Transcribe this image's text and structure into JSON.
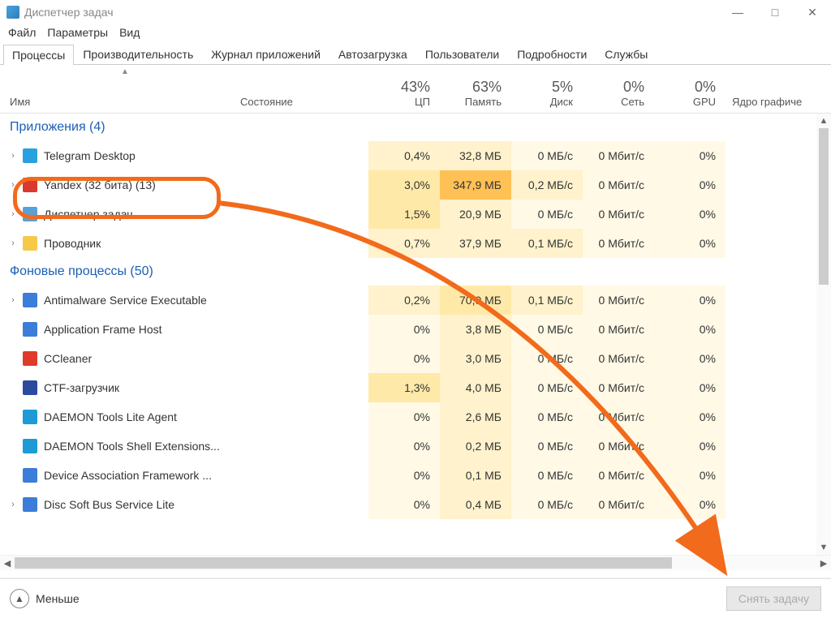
{
  "window": {
    "title": "Диспетчер задач"
  },
  "menubar": {
    "file": "Файл",
    "options": "Параметры",
    "view": "Вид"
  },
  "tabs": {
    "active": 0,
    "items": [
      "Процессы",
      "Производительность",
      "Журнал приложений",
      "Автозагрузка",
      "Пользователи",
      "Подробности",
      "Службы"
    ]
  },
  "columns": {
    "name": "Имя",
    "state": "Состояние",
    "cpu_pct": "43%",
    "cpu_lbl": "ЦП",
    "mem_pct": "63%",
    "mem_lbl": "Память",
    "disk_pct": "5%",
    "disk_lbl": "Диск",
    "net_pct": "0%",
    "net_lbl": "Сеть",
    "gpu_pct": "0%",
    "gpu_lbl": "GPU",
    "gpuEng_lbl": "Ядро графиче"
  },
  "groups": {
    "apps": "Приложения (4)",
    "bg": "Фоновые процессы (50)"
  },
  "rows": {
    "apps": [
      {
        "name": "Telegram Desktop",
        "icon": "#2aa1de",
        "expand": true,
        "cpu": "0,4%",
        "cpu_h": 1,
        "mem": "32,8 МБ",
        "mem_h": 1,
        "disk": "0 МБ/с",
        "disk_h": 0,
        "net": "0 Мбит/с",
        "net_h": 0,
        "gpu": "0%",
        "gpu_h": 0
      },
      {
        "name": "Yandex (32 бита) (13)",
        "icon": "#d93a2b",
        "expand": true,
        "cpu": "3,0%",
        "cpu_h": 2,
        "mem": "347,9 МБ",
        "mem_h": 4,
        "disk": "0,2 МБ/с",
        "disk_h": 1,
        "net": "0 Мбит/с",
        "net_h": 0,
        "gpu": "0%",
        "gpu_h": 0
      },
      {
        "name": "Диспетчер задач",
        "icon": "#5aa0d8",
        "expand": true,
        "cpu": "1,5%",
        "cpu_h": 2,
        "mem": "20,9 МБ",
        "mem_h": 1,
        "disk": "0 МБ/с",
        "disk_h": 0,
        "net": "0 Мбит/с",
        "net_h": 0,
        "gpu": "0%",
        "gpu_h": 0
      },
      {
        "name": "Проводник",
        "icon": "#f7c948",
        "expand": true,
        "cpu": "0,7%",
        "cpu_h": 1,
        "mem": "37,9 МБ",
        "mem_h": 1,
        "disk": "0,1 МБ/с",
        "disk_h": 1,
        "net": "0 Мбит/с",
        "net_h": 0,
        "gpu": "0%",
        "gpu_h": 0
      }
    ],
    "bg": [
      {
        "name": "Antimalware Service Executable",
        "icon": "#3b7dd8",
        "expand": true,
        "cpu": "0,2%",
        "cpu_h": 1,
        "mem": "70,9 МБ",
        "mem_h": 2,
        "disk": "0,1 МБ/с",
        "disk_h": 1,
        "net": "0 Мбит/с",
        "net_h": 0,
        "gpu": "0%",
        "gpu_h": 0
      },
      {
        "name": "Application Frame Host",
        "icon": "#3b7dd8",
        "expand": false,
        "cpu": "0%",
        "cpu_h": 0,
        "mem": "3,8 МБ",
        "mem_h": 1,
        "disk": "0 МБ/с",
        "disk_h": 0,
        "net": "0 Мбит/с",
        "net_h": 0,
        "gpu": "0%",
        "gpu_h": 0
      },
      {
        "name": "CCleaner",
        "icon": "#e03b2a",
        "expand": false,
        "cpu": "0%",
        "cpu_h": 0,
        "mem": "3,0 МБ",
        "mem_h": 1,
        "disk": "0 МБ/с",
        "disk_h": 0,
        "net": "0 Мбит/с",
        "net_h": 0,
        "gpu": "0%",
        "gpu_h": 0
      },
      {
        "name": "CTF-загрузчик",
        "icon": "#2b4aa0",
        "expand": false,
        "cpu": "1,3%",
        "cpu_h": 2,
        "mem": "4,0 МБ",
        "mem_h": 1,
        "disk": "0 МБ/с",
        "disk_h": 0,
        "net": "0 Мбит/с",
        "net_h": 0,
        "gpu": "0%",
        "gpu_h": 0
      },
      {
        "name": "DAEMON Tools Lite Agent",
        "icon": "#1e9ad6",
        "expand": false,
        "cpu": "0%",
        "cpu_h": 0,
        "mem": "2,6 МБ",
        "mem_h": 1,
        "disk": "0 МБ/с",
        "disk_h": 0,
        "net": "0 Мбит/с",
        "net_h": 0,
        "gpu": "0%",
        "gpu_h": 0
      },
      {
        "name": "DAEMON Tools Shell Extensions...",
        "icon": "#1e9ad6",
        "expand": false,
        "cpu": "0%",
        "cpu_h": 0,
        "mem": "0,2 МБ",
        "mem_h": 1,
        "disk": "0 МБ/с",
        "disk_h": 0,
        "net": "0 Мбит/с",
        "net_h": 0,
        "gpu": "0%",
        "gpu_h": 0
      },
      {
        "name": "Device Association Framework ...",
        "icon": "#3b7dd8",
        "expand": false,
        "cpu": "0%",
        "cpu_h": 0,
        "mem": "0,1 МБ",
        "mem_h": 1,
        "disk": "0 МБ/с",
        "disk_h": 0,
        "net": "0 Мбит/с",
        "net_h": 0,
        "gpu": "0%",
        "gpu_h": 0
      },
      {
        "name": "Disc Soft Bus Service Lite",
        "icon": "#3b7dd8",
        "expand": true,
        "cpu": "0%",
        "cpu_h": 0,
        "mem": "0,4 МБ",
        "mem_h": 1,
        "disk": "0 МБ/с",
        "disk_h": 0,
        "net": "0 Мбит/с",
        "net_h": 0,
        "gpu": "0%",
        "gpu_h": 0
      }
    ]
  },
  "footer": {
    "fewer": "Меньше",
    "end_task": "Снять задачу"
  }
}
